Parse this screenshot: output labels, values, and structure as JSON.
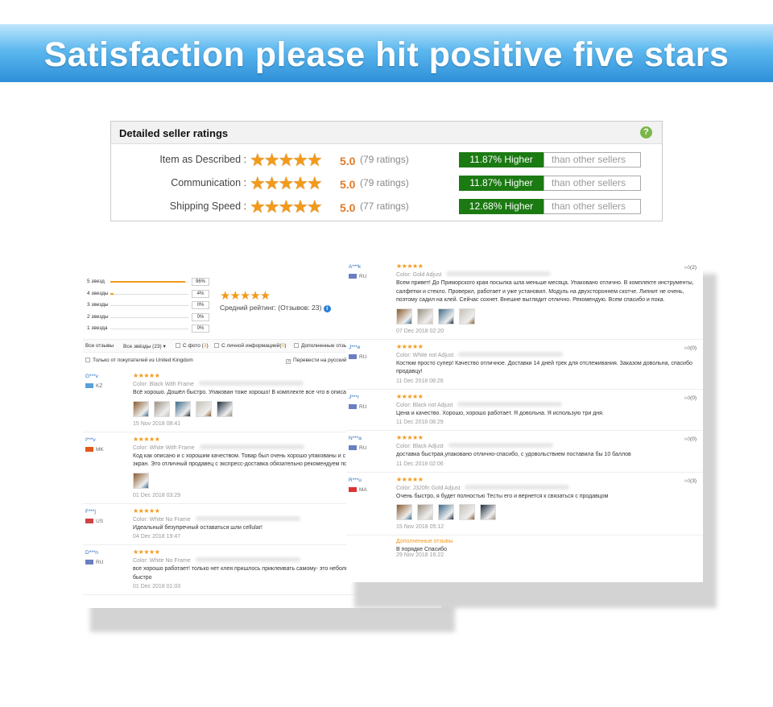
{
  "banner": {
    "title": "Satisfaction please hit positive five stars"
  },
  "seller_ratings": {
    "title": "Detailed seller ratings",
    "help_icon": "question-icon",
    "rows": [
      {
        "label": "Item as Described :",
        "stars": 5,
        "score": "5.0",
        "count": "(79 ratings)",
        "higher": "11.87% Higher",
        "than": "than other sellers"
      },
      {
        "label": "Communication :",
        "stars": 5,
        "score": "5.0",
        "count": "(79 ratings)",
        "higher": "11.87% Higher",
        "than": "than other sellers"
      },
      {
        "label": "Shipping Speed :",
        "stars": 5,
        "score": "5.0",
        "count": "(77 ratings)",
        "higher": "12.68% Higher",
        "than": "than other sellers"
      }
    ],
    "colors": {
      "higher_bg": "#1b7a12",
      "star": "#f29a1c",
      "score": "#e07b2a"
    }
  },
  "left_panel": {
    "distribution": [
      {
        "label": "5 звезд",
        "percent": 96,
        "text": "96%"
      },
      {
        "label": "4 звезды",
        "percent": 4,
        "text": "4%"
      },
      {
        "label": "3 звезды",
        "percent": 0,
        "text": "0%"
      },
      {
        "label": "2 звезды",
        "percent": 0,
        "text": "0%"
      },
      {
        "label": "1 звезда",
        "percent": 0,
        "text": "0%"
      }
    ],
    "average": {
      "stars": 5,
      "label": "Средний рейтинг:",
      "count": "(Отзывов: 23)"
    },
    "filters": {
      "all": "Все отзывы",
      "stars": "Все звёзды (23)",
      "photo": "С фото (",
      "photo_n": "3",
      "photo_end": ")",
      "personal": "С личной информацией(",
      "personal_n": "0",
      "personal_end": ")",
      "additional": "Дополненные отзы",
      "uk_only": "Только от покупателей из United Kingdom",
      "translate": "Перевести на русский"
    },
    "reviews": [
      {
        "name": "G***v",
        "country": "KZ",
        "flag": "#5aa0d8",
        "stars": 5,
        "color_label": "Color:",
        "color": "Black With Frame",
        "text": "Всё хорошо. Дошёл быстро. Упакован тоже хорошо! В комплекте все что в описани",
        "photos": 5,
        "date": "15 Nov 2018 08:41"
      },
      {
        "name": "I***v",
        "country": "MK",
        "flag": "#e05a1a",
        "stars": 5,
        "color_label": "Color:",
        "color": "White With Frame",
        "text": "Код как описано и с хорошим качеством. Товар был очень хорошо упакованы и с в необходимые, чтобы заменить экран. Это отличный продавец с экспресс-доставка обязательно рекомендуем покупать от thks магазине",
        "photos": 1,
        "date": "01 Dec 2018 03:29"
      },
      {
        "name": "F***j",
        "country": "US",
        "flag": "#c44",
        "stars": 5,
        "color_label": "Color:",
        "color": "White No Frame",
        "text": "Идеальный безупречный оставаться шли cellular!",
        "photos": 0,
        "date": "04 Dec 2018 19:47"
      },
      {
        "name": "D***n",
        "country": "RU",
        "flag": "#6a7fc0",
        "stars": 5,
        "color_label": "Color:",
        "color": "White No Frame",
        "text": "все хорошо работает! только нет клея пришлось приклеивать самому- это небольшой минус, пришло очень быстро",
        "photos": 0,
        "date": "01 Dec 2018 01:03"
      }
    ]
  },
  "right_panel": {
    "reviews": [
      {
        "name": "A***k",
        "country": "RU",
        "flag": "#6a7fc0",
        "stars": 5,
        "color_label": "Color:",
        "color": "Gold Adjust",
        "text": "Всем привет! До Приморского края посылка шла меньше месяца. Упаковано отлично. В комплекте инструменты, салфетки и стекло. Проверил, работает и уже установил. Модуль на двухстороннем скотче. Липнит не очень, поэтому садил на клей. Сейчас сохнет. Внешне выглядит отлично. Рекомендую. Всем спасибо и пока.",
        "photos": 4,
        "date": "07 Dec 2018 02:20",
        "likes": "(2)"
      },
      {
        "name": "J***e",
        "country": "RU",
        "flag": "#6a7fc0",
        "stars": 5,
        "color_label": "Color:",
        "color": "White not Adjust",
        "text": "Костюм просто супер! Качество отличное. Доставки 14 дней трек для отслеживания. Заказом довольна, спасибо продавцу!",
        "photos": 0,
        "date": "11 Dec 2018 08:26",
        "likes": "(0)"
      },
      {
        "name": "J***r",
        "country": "RU",
        "flag": "#6a7fc0",
        "stars": 5,
        "color_label": "Color:",
        "color": "Black not Adjust",
        "text": "Цена и качество. Хорошо, хорошо работает. Я довольна. Я использую три дня.",
        "photos": 0,
        "date": "11 Dec 2018 08:29",
        "likes": "(0)"
      },
      {
        "name": "N***a",
        "country": "RU",
        "flag": "#6a7fc0",
        "stars": 5,
        "color_label": "Color:",
        "color": "Black Adjust",
        "text": "доставка быстрая,упаковано отлично-спасибо, с удовольствием поставила бы 10 баллов",
        "photos": 0,
        "date": "11 Dec 2018 02:06",
        "likes": "(0)"
      },
      {
        "name": "R***u",
        "country": "MA",
        "flag": "#d33",
        "stars": 5,
        "color_label": "Color:",
        "color": "J320fn Gold Adjust",
        "text": "Очень быстро, я будет полностью Тесты его и вернется к связаться с продавцом",
        "photos": 5,
        "date": "15 Nov 2018 05:12",
        "likes": "(3)"
      }
    ],
    "additional": {
      "heading": "Дополненные отзывы",
      "text": "В порядке Спасибо",
      "date": "29 Nov 2018 16:22"
    }
  }
}
